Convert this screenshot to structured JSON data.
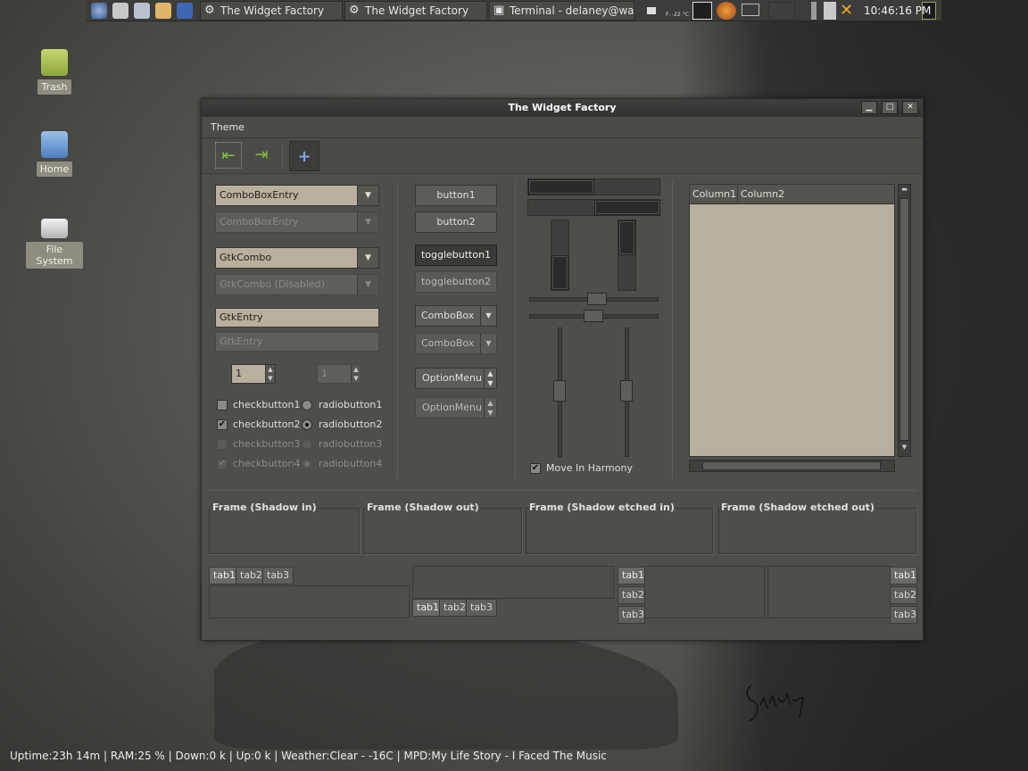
{
  "panel": {
    "tasks": [
      {
        "label": "The Widget Factory",
        "icon": "gear-icon"
      },
      {
        "label": "The Widget Factory",
        "icon": "gear-icon"
      },
      {
        "label": "Terminal - delaney@warr...",
        "icon": "terminal-icon"
      }
    ],
    "weather_tray": "F: -22 °C",
    "clock": "10:46:16 PM"
  },
  "desktop": {
    "icons": [
      {
        "label": "Trash",
        "icon": "trash-icon"
      },
      {
        "label": "Home",
        "icon": "home-folder-icon"
      },
      {
        "label": "File System",
        "icon": "drive-icon"
      }
    ]
  },
  "window": {
    "title": "The Widget Factory",
    "menu": [
      "Theme"
    ],
    "controls": {
      "minimize": "▁",
      "maximize": "□",
      "close": "✕"
    }
  },
  "col1": {
    "combobox_entry": "ComboBoxEntry",
    "combobox_entry_disabled": "ComboBoxEntry",
    "gtkcombo": "GtkCombo",
    "gtkcombo_disabled": "GtkCombo (Disabled)",
    "gtkentry": "GtkEntry",
    "gtkentry_disabled": "GtkEntry",
    "spin1": "1",
    "spin2": "1",
    "checks": [
      "checkbutton1",
      "checkbutton2",
      "checkbutton3",
      "checkbutton4"
    ],
    "radios": [
      "radiobutton1",
      "radiobutton2",
      "radiobutton3",
      "radiobutton4"
    ]
  },
  "col2": {
    "button1": "button1",
    "button2": "button2",
    "toggle1": "togglebutton1",
    "toggle2": "togglebutton2",
    "combo1": "ComboBox",
    "combo2": "ComboBox",
    "option1": "OptionMenu",
    "option2": "OptionMenu"
  },
  "col3": {
    "move_in_harmony": "Move In Harmony"
  },
  "tree": {
    "columns": [
      "Column1",
      "Column2"
    ]
  },
  "frames": [
    "Frame (Shadow in)",
    "Frame (Shadow out)",
    "Frame (Shadow etched in)",
    "Frame (Shadow etched out)"
  ],
  "notebooks": {
    "tabs": [
      "tab1",
      "tab2",
      "tab3"
    ]
  },
  "statusbar": "Uptime:23h 14m | RAM:25 % | Down:0    k | Up:0    k | Weather:Clear - -16C | MPD:My Life Story - I Faced The Music",
  "signature": "Stanley",
  "colors": {
    "accent": "#b8b09e",
    "window_bg": "#4e4e4b",
    "desktop": "#5a5a57"
  }
}
